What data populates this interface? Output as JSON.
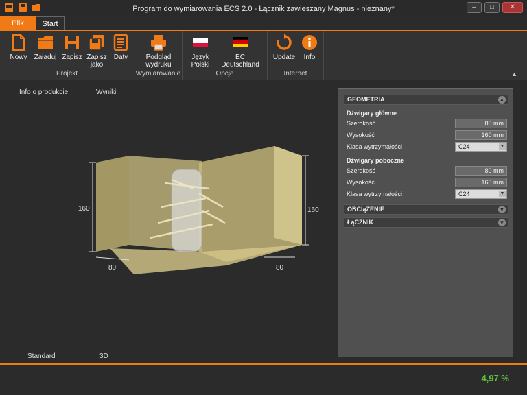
{
  "window": {
    "title": "Program do wymiarowania ECS 2.0 - Łącznik zawieszany Magnus - nieznany*",
    "controls": [
      "–",
      "□",
      "✕"
    ]
  },
  "tabs": {
    "file": "Plik",
    "start": "Start"
  },
  "ribbon": {
    "groups": {
      "projekt": "Projekt",
      "wymiarowanie": "Wymiarowanie",
      "opcje": "Opcje",
      "internet": "Internet"
    },
    "buttons": {
      "nowy": "Nowy",
      "zaladuj": "Załaduj",
      "zapisz": "Zapisz",
      "zapisz_jako_1": "Zapisz",
      "zapisz_jako_2": "jako",
      "daty": "Daty",
      "podglad_1": "Podgląd",
      "podglad_2": "wydruku",
      "polski_1": "Język",
      "polski_2": "Polski",
      "ec_1": "EC",
      "ec_2": "Deutschland",
      "update": "Update",
      "info": "Info"
    }
  },
  "view": {
    "top_tabs": [
      "Info o produkcie",
      "Wyniki"
    ],
    "bottom_tabs": [
      "Standard",
      "3D"
    ],
    "dims": {
      "left_height": "160",
      "right_height": "160",
      "left_width": "80",
      "right_width": "80"
    }
  },
  "panel": {
    "geometria": "GEOMETRIA",
    "glowne_title": "Dźwigary główne",
    "poboczne_title": "Dźwigary poboczne",
    "szerokosc": "Szerokość",
    "wysokosc": "Wysokość",
    "klasa": "Klasa wytrzymałości",
    "glowne": {
      "szerokosc": "80 mm",
      "wysokosc": "160 mm",
      "klasa": "C24"
    },
    "poboczne": {
      "szerokosc": "80 mm",
      "wysokosc": "160 mm",
      "klasa": "C24"
    },
    "obciazenie": "OBCIąŻENIE",
    "lacznik": "ŁąCZNIK"
  },
  "status": {
    "percent": "4,97 %"
  },
  "colors": {
    "accent": "#f07a16",
    "ok": "#5cc23c"
  }
}
